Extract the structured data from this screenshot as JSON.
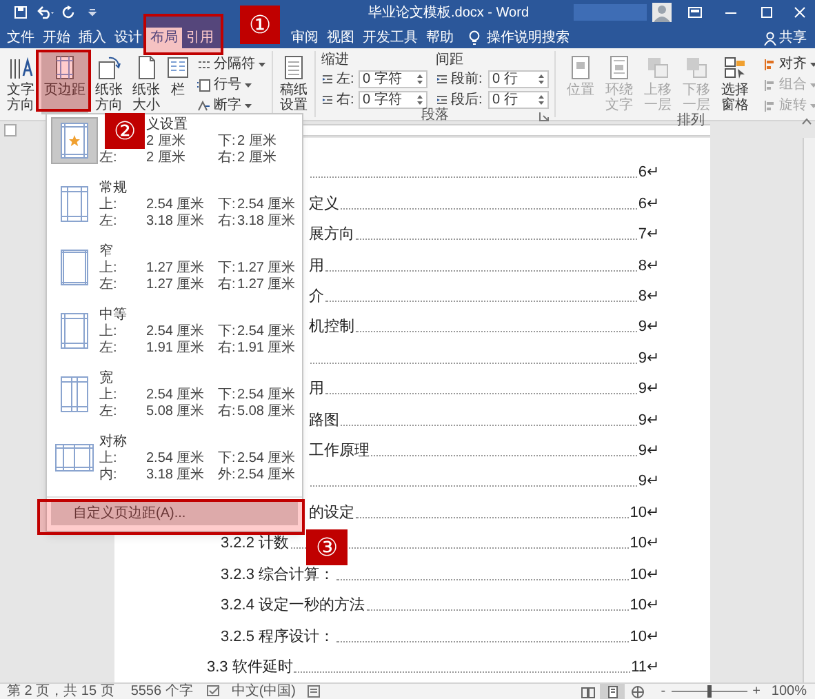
{
  "title_bar": {
    "title": "毕业论文模板.docx - Word"
  },
  "tabs": [
    {
      "label": "文件",
      "selected": false
    },
    {
      "label": "开始",
      "selected": false
    },
    {
      "label": "插入",
      "selected": false
    },
    {
      "label": "设计",
      "selected": false
    },
    {
      "label": "布局",
      "selected": true
    },
    {
      "label": "引用",
      "selected": false
    },
    {
      "label": "审阅",
      "selected": false
    },
    {
      "label": "视图",
      "selected": false
    },
    {
      "label": "开发工具",
      "selected": false
    },
    {
      "label": "帮助",
      "selected": false
    }
  ],
  "tell_me": {
    "placeholder": "操作说明搜索"
  },
  "share": "共享",
  "ribbon": {
    "page_setup": {
      "buttons": [
        {
          "kind": "text_direction",
          "label": "文字方向",
          "selected": false
        },
        {
          "kind": "margins",
          "label": "页边距",
          "selected": true
        },
        {
          "kind": "orientation",
          "label": "纸张方向",
          "selected": false
        },
        {
          "kind": "size",
          "label": "纸张大小",
          "selected": false
        },
        {
          "kind": "columns",
          "label": "栏",
          "selected": false
        }
      ],
      "small_buttons": [
        {
          "label": "分隔符"
        },
        {
          "label": "行号"
        },
        {
          "label": "断字"
        }
      ]
    },
    "manuscript": {
      "label": "稿纸设置"
    },
    "paragraph": {
      "label": "段落",
      "indent_title": "缩进",
      "spacing_title": "间距",
      "indent": [
        {
          "label": "左:",
          "value": "0 字符"
        },
        {
          "label": "右:",
          "value": "0 字符"
        }
      ],
      "spacing": [
        {
          "label": "段前:",
          "value": "0 行"
        },
        {
          "label": "段后:",
          "value": "0 行"
        }
      ]
    },
    "arrange": {
      "label": "排列",
      "buttons": [
        {
          "label": "位置",
          "disabled": true
        },
        {
          "label": "环绕文字",
          "disabled": true
        },
        {
          "label": "上移一层",
          "disabled": true
        },
        {
          "label": "下移一层",
          "disabled": true
        },
        {
          "label": "选择窗格",
          "disabled": false
        }
      ],
      "small_buttons": [
        {
          "label": "对齐",
          "disabled": false
        },
        {
          "label": "组合",
          "disabled": true
        },
        {
          "label": "旋转",
          "disabled": true
        }
      ]
    }
  },
  "margins_menu": {
    "items": [
      {
        "kind": "last_custom",
        "title": "义设置",
        "selected": true,
        "rows": [
          {
            "value_1": "2 厘米",
            "label_2": "下:",
            "value_2": "2 厘米"
          },
          {
            "label_1": "左:",
            "value_1": "2 厘米",
            "label_2": "右:",
            "value_2": "2 厘米"
          }
        ]
      },
      {
        "kind": "normal",
        "title": "常规",
        "selected": false,
        "rows": [
          {
            "label_1": "上:",
            "value_1": "2.54 厘米",
            "label_2": "下:",
            "value_2": "2.54 厘米"
          },
          {
            "label_1": "左:",
            "value_1": "3.18 厘米",
            "label_2": "右:",
            "value_2": "3.18 厘米"
          }
        ]
      },
      {
        "kind": "narrow",
        "title": "窄",
        "selected": false,
        "rows": [
          {
            "label_1": "上:",
            "value_1": "1.27 厘米",
            "label_2": "下:",
            "value_2": "1.27 厘米"
          },
          {
            "label_1": "左:",
            "value_1": "1.27 厘米",
            "label_2": "右:",
            "value_2": "1.27 厘米"
          }
        ]
      },
      {
        "kind": "moderate",
        "title": "中等",
        "selected": false,
        "rows": [
          {
            "label_1": "上:",
            "value_1": "2.54 厘米",
            "label_2": "下:",
            "value_2": "2.54 厘米"
          },
          {
            "label_1": "左:",
            "value_1": "1.91 厘米",
            "label_2": "右:",
            "value_2": "1.91 厘米"
          }
        ]
      },
      {
        "kind": "wide",
        "title": "宽",
        "selected": false,
        "rows": [
          {
            "label_1": "上:",
            "value_1": "2.54 厘米",
            "label_2": "下:",
            "value_2": "2.54 厘米"
          },
          {
            "label_1": "左:",
            "value_1": "5.08 厘米",
            "label_2": "右:",
            "value_2": "5.08 厘米"
          }
        ]
      },
      {
        "kind": "mirrored",
        "title": "对称",
        "selected": false,
        "rows": [
          {
            "label_1": "上:",
            "value_1": "2.54 厘米",
            "label_2": "下:",
            "value_2": "2.54 厘米"
          },
          {
            "label_1": "内:",
            "value_1": "3.18 厘米",
            "label_2": "外:",
            "value_2": "2.54 厘米"
          }
        ]
      }
    ],
    "custom": "自定义页边距(A)..."
  },
  "document": {
    "toc": [
      {
        "kind": "cut",
        "page": "6↵"
      },
      {
        "kind": "cut",
        "text": "定义",
        "page": "6↵"
      },
      {
        "kind": "cut",
        "text": "展方向",
        "page": "7↵"
      },
      {
        "kind": "cut",
        "text": "用",
        "page": "8↵"
      },
      {
        "kind": "cut",
        "text": "介",
        "page": "8↵"
      },
      {
        "kind": "cut",
        "text": "机控制",
        "page": "9↵"
      },
      {
        "kind": "cut",
        "page": "9↵"
      },
      {
        "kind": "cut",
        "text": "用",
        "page": "9↵"
      },
      {
        "kind": "cut",
        "text": "路图",
        "page": "9↵"
      },
      {
        "kind": "cut",
        "text": "工作原理",
        "page": "9↵"
      },
      {
        "kind": "cut",
        "page": "9↵"
      },
      {
        "kind": "cut",
        "text": "的设定",
        "page": "10↵"
      },
      {
        "kind": "subsection",
        "text": "3.2.2 计数",
        "page": "10↵"
      },
      {
        "kind": "subsection",
        "text": "3.2.3 综合计算：",
        "page": "10↵"
      },
      {
        "kind": "subsection",
        "text": "3.2.4 设定一秒的方法",
        "page": "10↵"
      },
      {
        "kind": "subsection",
        "text": "3.2.5 程序设计：",
        "page": "10↵"
      },
      {
        "kind": "section",
        "text": "3.3 软件延时",
        "page": "11↵"
      }
    ]
  },
  "status_bar": {
    "page": "第 2 页，共 15 页",
    "words": "5556 个字",
    "language": "中文(中国)",
    "views": [
      {
        "kind": "read",
        "selected": false
      },
      {
        "kind": "print",
        "selected": true
      },
      {
        "kind": "web",
        "selected": false
      }
    ],
    "zoom_out": "-",
    "zoom_in": "+",
    "zoom": {
      "level": 0.5,
      "reading": "100%"
    }
  },
  "annotations": [
    {
      "label": "①"
    },
    {
      "label": "②"
    },
    {
      "label": "③"
    }
  ]
}
